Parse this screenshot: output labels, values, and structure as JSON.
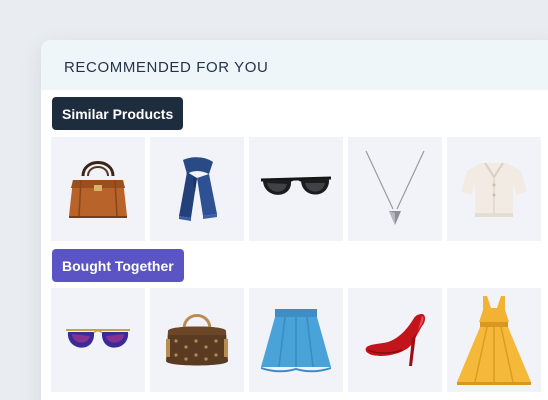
{
  "panel": {
    "title": "RECOMMENDED FOR YOU"
  },
  "sections": {
    "similar": {
      "label": "Similar Products",
      "color": "#1e2d3d",
      "items": [
        "handbag-icon",
        "scarf-icon",
        "sunglasses-icon",
        "necklace-icon",
        "blouse-icon"
      ]
    },
    "bought_together": {
      "label": "Bought Together",
      "color": "#5a54c4",
      "items": [
        "aviator-sunglasses-icon",
        "duffle-bag-icon",
        "skirt-icon",
        "high-heel-icon",
        "dress-icon"
      ]
    }
  }
}
